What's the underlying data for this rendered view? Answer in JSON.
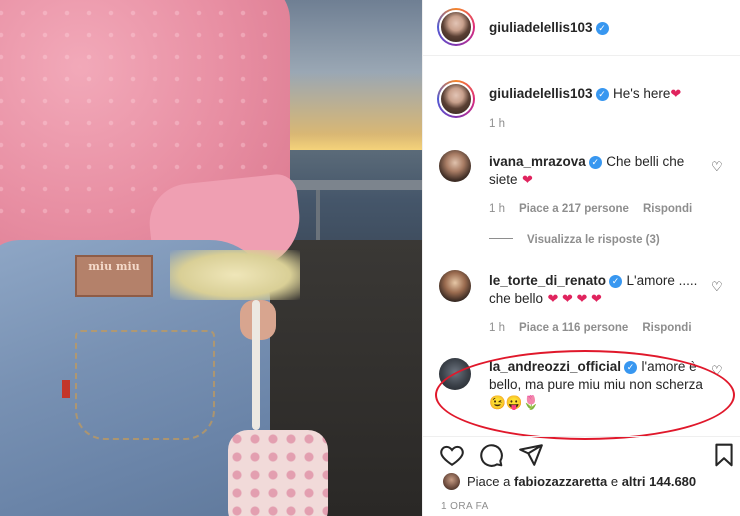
{
  "post": {
    "author": "giuliadelellis103",
    "caption": "He's here",
    "caption_emoji": "❤",
    "caption_time": "1 h",
    "photo_label": "miu miu"
  },
  "comments": [
    {
      "user": "ivana_mrazova",
      "verified": true,
      "text": "Che belli che siete",
      "emoji": "❤",
      "time": "1 h",
      "likes": "Piace a 217 persone",
      "reply": "Rispondi"
    },
    {
      "user": "le_torte_di_renato",
      "verified": true,
      "text": "L'amore ..... che bello",
      "emoji": "❤ ❤ ❤ ❤",
      "time": "1 h",
      "likes": "Piace a 116 persone",
      "reply": "Rispondi"
    },
    {
      "user": "la_andreozzi_official",
      "verified": true,
      "text": "l'amore è bello, ma pure miu miu non scherza",
      "emoji": "😉😛🌷"
    }
  ],
  "view_replies": "Visualizza le risposte (3)",
  "likes_summary": {
    "prefix": "Piace a",
    "user": "fabiozazzaretta",
    "middle": "e",
    "others": "altri 144.680"
  },
  "post_time": "1 ORA FA",
  "icons": {
    "like": "heart-outline-icon",
    "comment": "comment-bubble-icon",
    "share": "paper-plane-icon",
    "save": "bookmark-icon",
    "verified": "verified-badge-icon"
  },
  "colors": {
    "verified": "#3897f0",
    "highlight_circle": "#e0182b",
    "muted_text": "#8e8e8e"
  }
}
